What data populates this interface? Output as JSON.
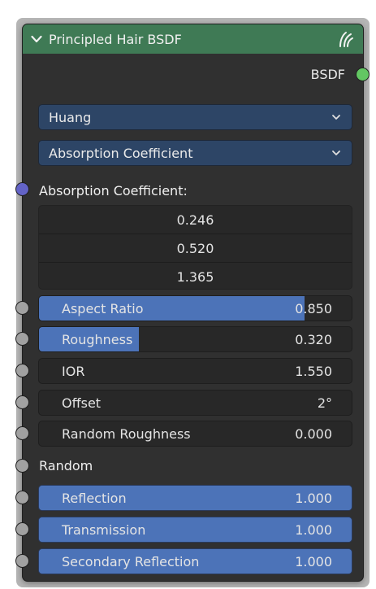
{
  "node": {
    "title": "Principled Hair BSDF",
    "header_color": "#3f7a55",
    "icon": "hair-icon",
    "output_label": "BSDF",
    "output_socket_color": "#63c763"
  },
  "dropdowns": {
    "model": "Huang",
    "parametrization": "Absorption Coefficient"
  },
  "absorption": {
    "label": "Absorption Coefficient:",
    "socket_color": "#6363c7",
    "values": [
      "0.246",
      "0.520",
      "1.365"
    ]
  },
  "fields": [
    {
      "label": "Aspect Ratio",
      "value": "0.850",
      "fill": 0.85
    },
    {
      "label": "Roughness",
      "value": "0.320",
      "fill": 0.32
    },
    {
      "label": "IOR",
      "value": "1.550",
      "fill": 0
    },
    {
      "label": "Offset",
      "value": "2°",
      "fill": 0
    },
    {
      "label": "Random Roughness",
      "value": "0.000",
      "fill": 0
    }
  ],
  "random": {
    "label": "Random"
  },
  "fields2": [
    {
      "label": "Reflection",
      "value": "1.000",
      "fill": 1
    },
    {
      "label": "Transmission",
      "value": "1.000",
      "fill": 1
    },
    {
      "label": "Secondary Reflection",
      "value": "1.000",
      "fill": 1
    }
  ],
  "colors": {
    "field_fill": "#4c73b8",
    "dropdown_bg": "#2d4566",
    "node_bg": "#303030"
  }
}
